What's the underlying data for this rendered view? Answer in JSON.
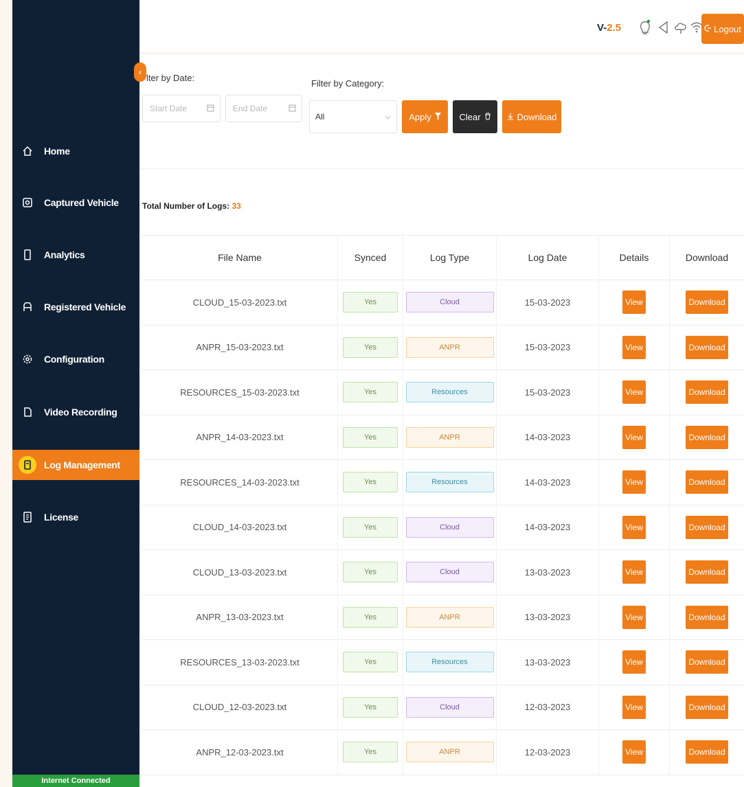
{
  "header": {
    "version_prefix": "V-",
    "version_number": "2.5",
    "logout_label": "Logout"
  },
  "sidebar": {
    "items": [
      {
        "label": "Home",
        "icon": "home-icon"
      },
      {
        "label": "Captured Vehicle",
        "icon": "camera-icon"
      },
      {
        "label": "Analytics",
        "icon": "analytics-icon"
      },
      {
        "label": "Registered Vehicle",
        "icon": "car-icon"
      },
      {
        "label": "Configuration",
        "icon": "gear-icon"
      },
      {
        "label": "Video Recording",
        "icon": "video-icon"
      },
      {
        "label": "Log Management",
        "icon": "log-icon",
        "active": true
      },
      {
        "label": "License",
        "icon": "license-icon"
      }
    ],
    "status": "Internet Connected"
  },
  "filters": {
    "date_label": "lter by Date:",
    "start_placeholder": "Start Date",
    "end_placeholder": "End Date",
    "category_label": "Filter by Category:",
    "category_value": "All",
    "apply_label": "Apply",
    "clear_label": "Clear",
    "download_label": "Download"
  },
  "summary": {
    "total_label": "Total Number of Logs:",
    "total_count": "33"
  },
  "table": {
    "headers": [
      "File Name",
      "Synced",
      "Log Type",
      "Log Date",
      "Details",
      "Download"
    ],
    "view_label": "View",
    "download_label": "Download",
    "rows": [
      {
        "file": "CLOUD_15-03-2023.txt",
        "synced": "Yes",
        "type": "Cloud",
        "date": "15-03-2023"
      },
      {
        "file": "ANPR_15-03-2023.txt",
        "synced": "Yes",
        "type": "ANPR",
        "date": "15-03-2023"
      },
      {
        "file": "RESOURCES_15-03-2023.txt",
        "synced": "Yes",
        "type": "Resources",
        "date": "15-03-2023"
      },
      {
        "file": "ANPR_14-03-2023.txt",
        "synced": "Yes",
        "type": "ANPR",
        "date": "14-03-2023"
      },
      {
        "file": "RESOURCES_14-03-2023.txt",
        "synced": "Yes",
        "type": "Resources",
        "date": "14-03-2023"
      },
      {
        "file": "CLOUD_14-03-2023.txt",
        "synced": "Yes",
        "type": "Cloud",
        "date": "14-03-2023"
      },
      {
        "file": "CLOUD_13-03-2023.txt",
        "synced": "Yes",
        "type": "Cloud",
        "date": "13-03-2023"
      },
      {
        "file": "ANPR_13-03-2023.txt",
        "synced": "Yes",
        "type": "ANPR",
        "date": "13-03-2023"
      },
      {
        "file": "RESOURCES_13-03-2023.txt",
        "synced": "Yes",
        "type": "Resources",
        "date": "13-03-2023"
      },
      {
        "file": "CLOUD_12-03-2023.txt",
        "synced": "Yes",
        "type": "Cloud",
        "date": "12-03-2023"
      },
      {
        "file": "ANPR_12-03-2023.txt",
        "synced": "Yes",
        "type": "ANPR",
        "date": "12-03-2023"
      }
    ]
  },
  "colors": {
    "accent": "#ef7d1a",
    "sidebar_bg": "#0f2035",
    "status_green": "#2a9d3c"
  }
}
